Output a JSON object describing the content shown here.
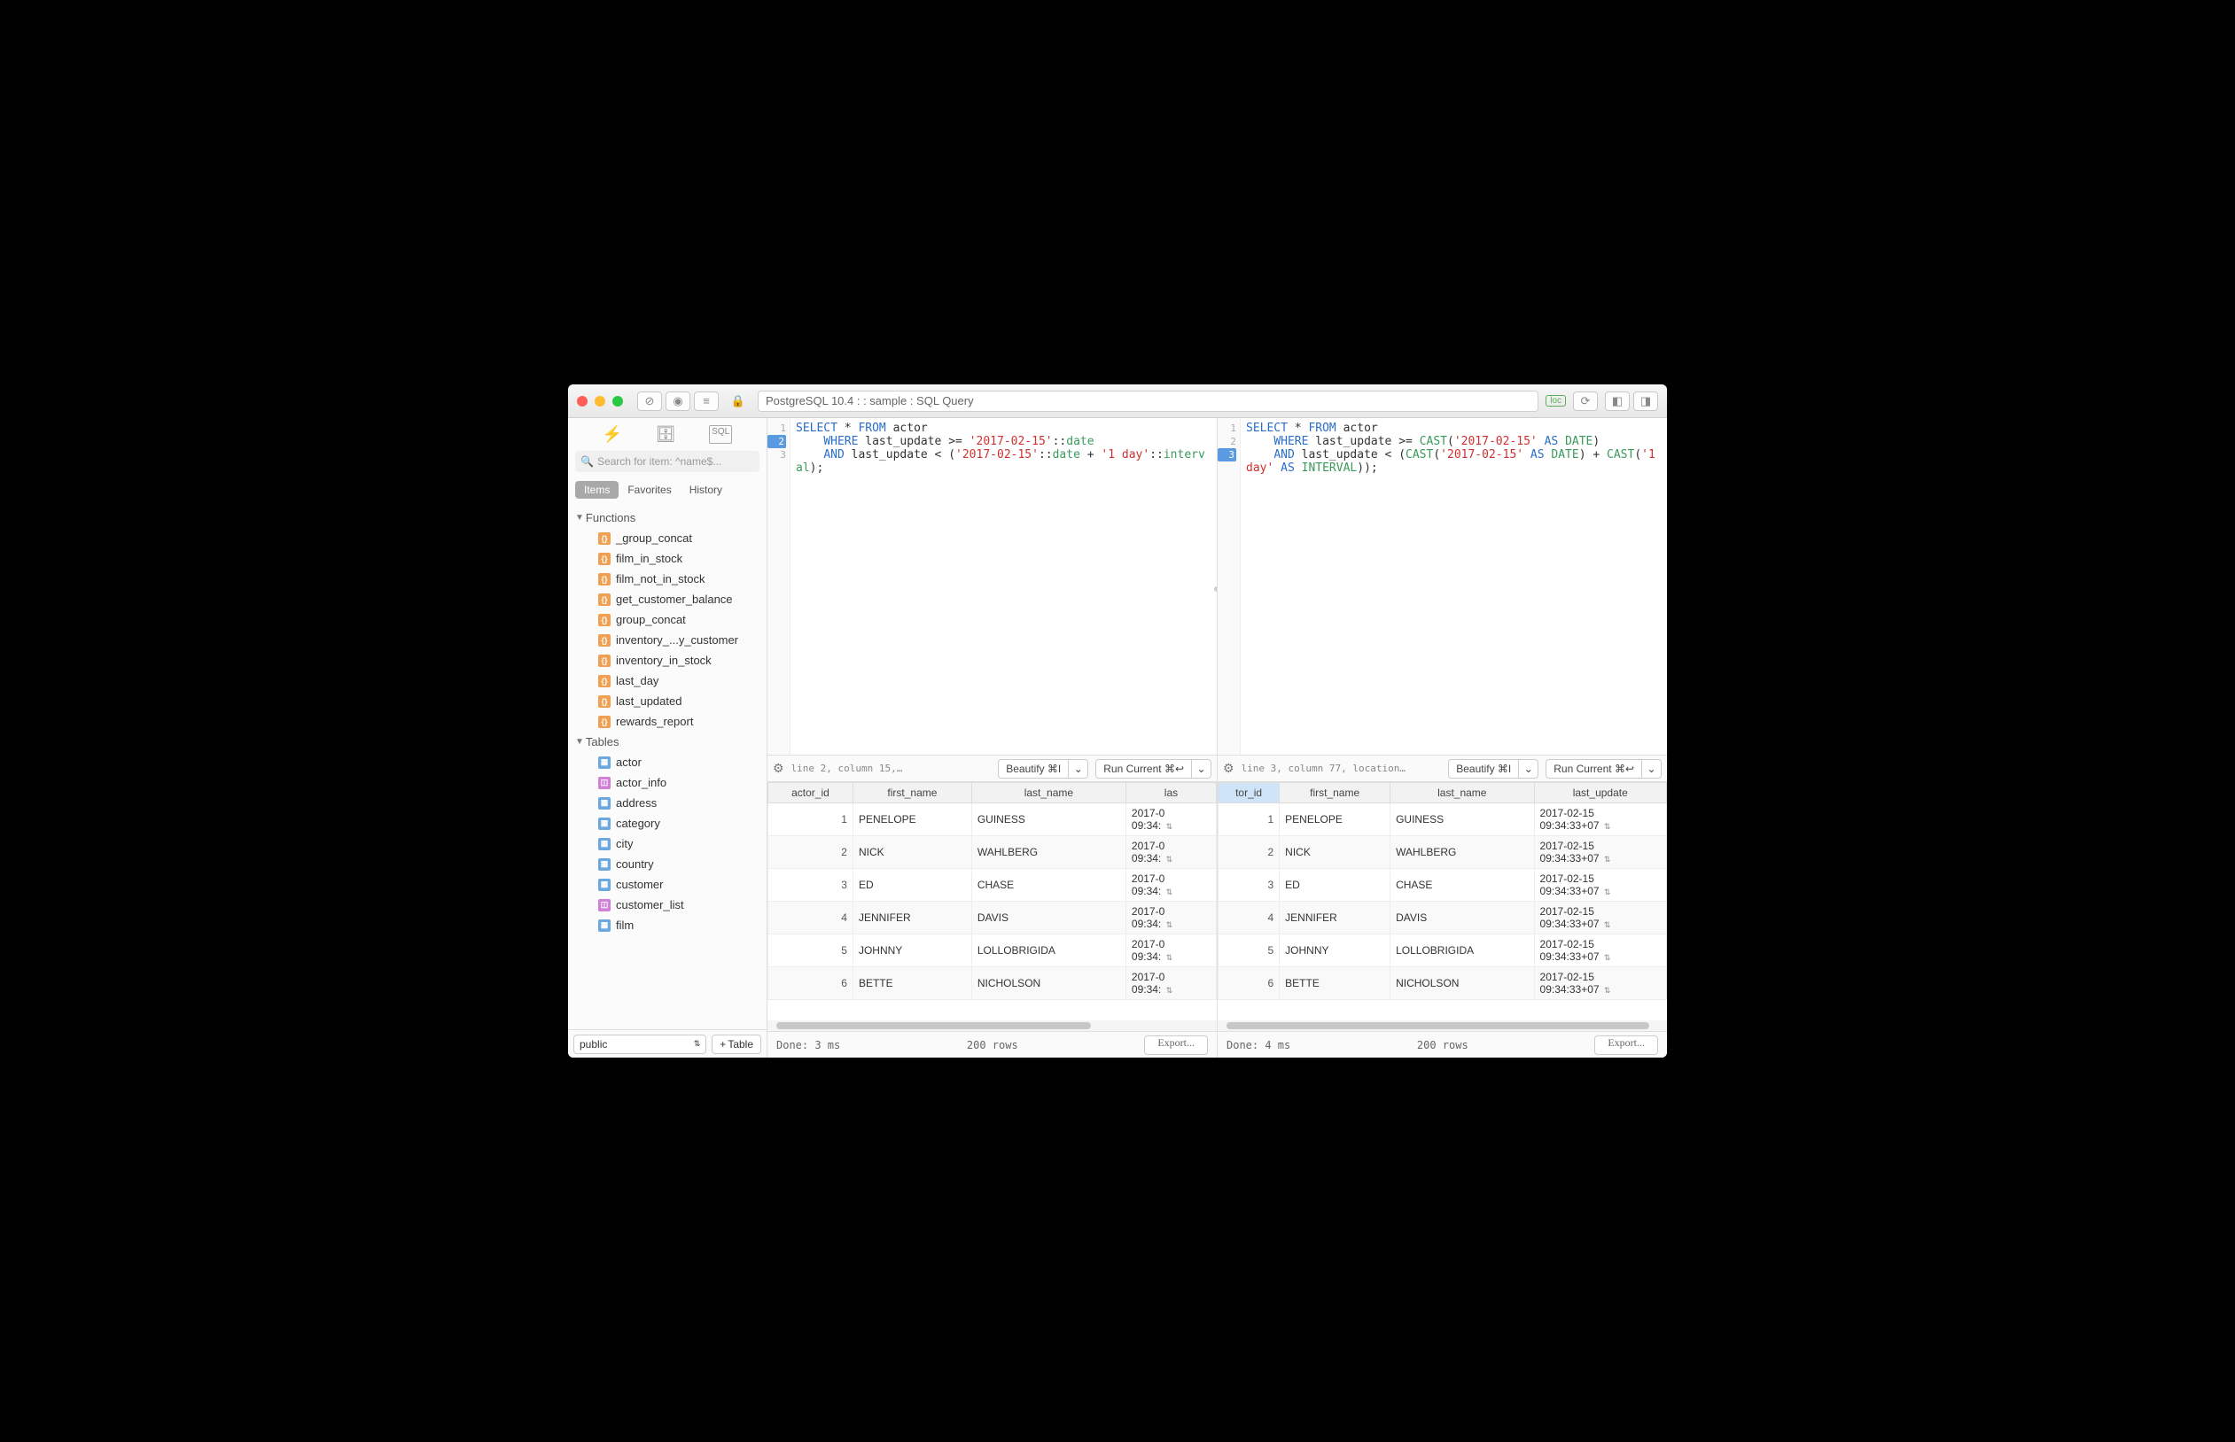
{
  "titlebar": {
    "title": "PostgreSQL 10.4 :  : sample : SQL Query",
    "loc_badge": "loc"
  },
  "sidebar": {
    "search_placeholder": "Search for item: ^name$...",
    "tabs": {
      "items": "Items",
      "favorites": "Favorites",
      "history": "History"
    },
    "sections": {
      "functions": "Functions",
      "tables": "Tables"
    },
    "functions": [
      "_group_concat",
      "film_in_stock",
      "film_not_in_stock",
      "get_customer_balance",
      "group_concat",
      "inventory_...y_customer",
      "inventory_in_stock",
      "last_day",
      "last_updated",
      "rewards_report"
    ],
    "tables": [
      {
        "n": "actor",
        "t": "tb"
      },
      {
        "n": "actor_info",
        "t": "vw"
      },
      {
        "n": "address",
        "t": "tb"
      },
      {
        "n": "category",
        "t": "tb"
      },
      {
        "n": "city",
        "t": "tb"
      },
      {
        "n": "country",
        "t": "tb"
      },
      {
        "n": "customer",
        "t": "tb"
      },
      {
        "n": "customer_list",
        "t": "vw"
      },
      {
        "n": "film",
        "t": "tb"
      }
    ],
    "schema": "public",
    "add_table": "Table"
  },
  "panes": [
    {
      "code_html": "<span class='kw'>SELECT</span> * <span class='kw'>FROM</span> actor\n    <span class='kw'>WHERE</span> last_update &gt;= <span class='str'>'2017-02-15'</span>::<span class='type'>date</span>\n    <span class='kw'>AND</span> last_update &lt; (<span class='str'>'2017-02-15'</span>::<span class='type'>date</span> + <span class='str'>'1 day'</span>::<span class='type'>interval</span>);",
      "lines": [
        "1",
        "2",
        "3"
      ],
      "hl_line": 1,
      "bar_status": "line 2, column 15,…",
      "beautify": "Beautify ⌘I",
      "run": "Run Current ⌘↩",
      "columns": [
        "actor_id",
        "first_name",
        "last_name",
        "las"
      ],
      "sel_col": -1,
      "rows": [
        [
          "1",
          "PENELOPE",
          "GUINESS",
          "2017-0\n09:34:"
        ],
        [
          "2",
          "NICK",
          "WAHLBERG",
          "2017-0\n09:34:"
        ],
        [
          "3",
          "ED",
          "CHASE",
          "2017-0\n09:34:"
        ],
        [
          "4",
          "JENNIFER",
          "DAVIS",
          "2017-0\n09:34:"
        ],
        [
          "5",
          "JOHNNY",
          "LOLLOBRIGIDA",
          "2017-0\n09:34:"
        ],
        [
          "6",
          "BETTE",
          "NICHOLSON",
          "2017-0\n09:34:"
        ]
      ],
      "status_left": "Done: 3 ms",
      "status_mid": "200 rows",
      "export": "Export..."
    },
    {
      "code_html": "<span class='kw'>SELECT</span> * <span class='kw'>FROM</span> actor\n    <span class='kw'>WHERE</span> last_update &gt;= <span class='fn'>CAST</span>(<span class='str'>'2017-02-15'</span> <span class='kw'>AS</span> <span class='type'>DATE</span>)\n    <span class='kw'>AND</span> last_update &lt; (<span class='fn'>CAST</span>(<span class='str'>'2017-02-15'</span> <span class='kw'>AS</span> <span class='type'>DATE</span>) + <span class='fn'>CAST</span>(<span class='str'>'1 day'</span> <span class='kw'>AS</span> <span class='type'>INTERVAL</span>));",
      "lines": [
        "1",
        "2",
        "3"
      ],
      "hl_line": 2,
      "bar_status": "line 3, column 77, location…",
      "beautify": "Beautify ⌘I",
      "run": "Run Current ⌘↩",
      "columns": [
        "tor_id",
        "first_name",
        "last_name",
        "last_update"
      ],
      "sel_col": 0,
      "rows": [
        [
          "1",
          "PENELOPE",
          "GUINESS",
          "2017-02-15\n09:34:33+07"
        ],
        [
          "2",
          "NICK",
          "WAHLBERG",
          "2017-02-15\n09:34:33+07"
        ],
        [
          "3",
          "ED",
          "CHASE",
          "2017-02-15\n09:34:33+07"
        ],
        [
          "4",
          "JENNIFER",
          "DAVIS",
          "2017-02-15\n09:34:33+07"
        ],
        [
          "5",
          "JOHNNY",
          "LOLLOBRIGIDA",
          "2017-02-15\n09:34:33+07"
        ],
        [
          "6",
          "BETTE",
          "NICHOLSON",
          "2017-02-15\n09:34:33+07"
        ]
      ],
      "status_left": "Done: 4 ms",
      "status_mid": "200 rows",
      "export": "Export..."
    }
  ]
}
